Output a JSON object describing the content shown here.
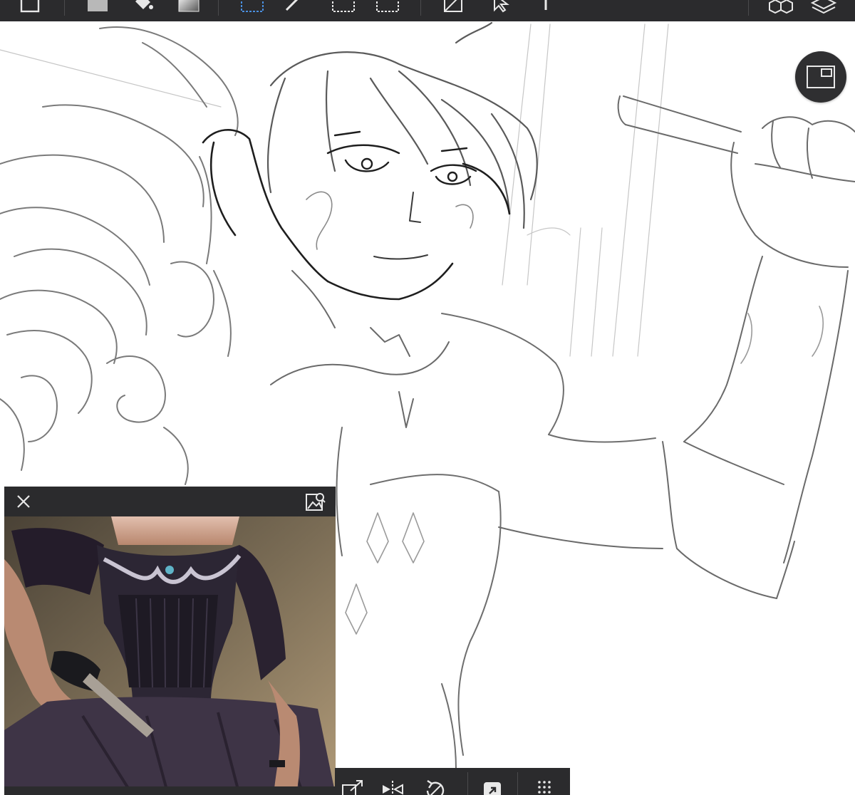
{
  "app": {
    "name": "drawing-app"
  },
  "colors": {
    "toolbar_bg": "#2b2b2d",
    "icon": "#e8e8e8",
    "accent_select": "#4a8fe0",
    "canvas_bg": "#ffffff",
    "stroke_dark": "#1e1e1e",
    "stroke_light": "#9a9a9a"
  },
  "top_toolbar": {
    "tools": [
      {
        "name": "frame-tool",
        "icon": "square-outline-icon"
      },
      {
        "name": "fill-color",
        "icon": "gray-swatch-icon"
      },
      {
        "name": "paint-bucket-tool",
        "icon": "bucket-icon"
      },
      {
        "name": "gradient-tool",
        "icon": "gradient-icon"
      },
      {
        "name": "rectangle-select-tool",
        "icon": "dashed-rect-blue-icon"
      },
      {
        "name": "magic-wand-tool",
        "icon": "wand-icon"
      },
      {
        "name": "select-pen-tool",
        "icon": "dashed-rect-icon"
      },
      {
        "name": "select-eraser-tool",
        "icon": "dashed-rect-icon"
      },
      {
        "name": "transform-tool",
        "icon": "transform-icon"
      },
      {
        "name": "move-tool",
        "icon": "arrow-icon"
      },
      {
        "name": "text-tool",
        "icon": "text-icon"
      },
      {
        "name": "3d-materials",
        "icon": "cubes-icon"
      },
      {
        "name": "layers",
        "icon": "layers-icon"
      }
    ]
  },
  "canvas": {
    "view_toggle_icon": "fullscreen-icon"
  },
  "reference_panel": {
    "close_icon": "close-icon",
    "pick_icon": "image-picker-icon"
  },
  "bottom_toolbar": {
    "tools": [
      {
        "name": "resize",
        "icon": "resize-icon"
      },
      {
        "name": "flip-horizontal",
        "icon": "flip-icon"
      },
      {
        "name": "rotate",
        "icon": "rotate-icon"
      },
      {
        "name": "export",
        "icon": "export-icon"
      },
      {
        "name": "more",
        "icon": "grid-dots-icon"
      }
    ]
  }
}
